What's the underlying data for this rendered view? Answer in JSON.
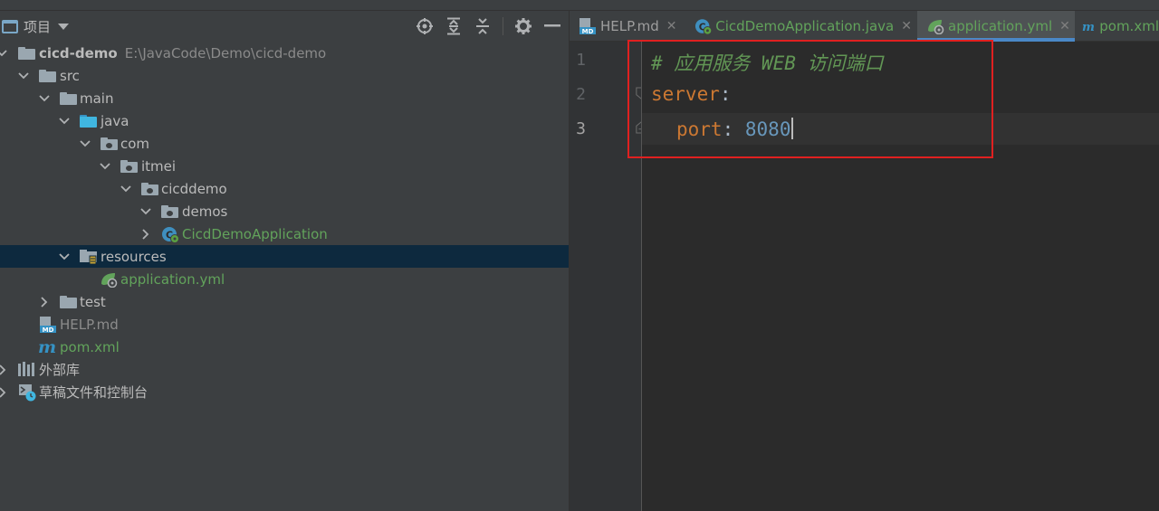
{
  "project_panel": {
    "title": "项目",
    "tree": [
      {
        "label": "cicd-demo",
        "path": "E:\\JavaCode\\Demo\\cicd-demo"
      },
      {
        "label": "src"
      },
      {
        "label": "main"
      },
      {
        "label": "java"
      },
      {
        "label": "com"
      },
      {
        "label": "itmei"
      },
      {
        "label": "cicddemo"
      },
      {
        "label": "demos"
      },
      {
        "label": "CicdDemoApplication"
      },
      {
        "label": "resources"
      },
      {
        "label": "application.yml"
      },
      {
        "label": "test"
      },
      {
        "label": "HELP.md"
      },
      {
        "label": "pom.xml"
      },
      {
        "label": "外部库"
      },
      {
        "label": "草稿文件和控制台"
      }
    ]
  },
  "tabs": [
    {
      "label": "HELP.md",
      "icon": "markdown-icon"
    },
    {
      "label": "CicdDemoApplication.java",
      "icon": "spring-class-icon"
    },
    {
      "label": "application.yml",
      "icon": "spring-yaml-icon",
      "active": true
    },
    {
      "label": "pom.xml",
      "icon": "maven-icon"
    }
  ],
  "editor": {
    "line_numbers": [
      "1",
      "2",
      "3"
    ],
    "lines": {
      "comment": "# 应用服务 WEB 访问端口",
      "server_key": "server",
      "port_key": "port",
      "colon": ":",
      "port_value": "8080"
    }
  },
  "colors": {
    "accent": "#4a88c7",
    "selection": "#0d293e",
    "highlight_box": "#e02020",
    "yaml_key": "#cc7832",
    "yaml_comment": "#629755",
    "yaml_number": "#6897bb"
  }
}
